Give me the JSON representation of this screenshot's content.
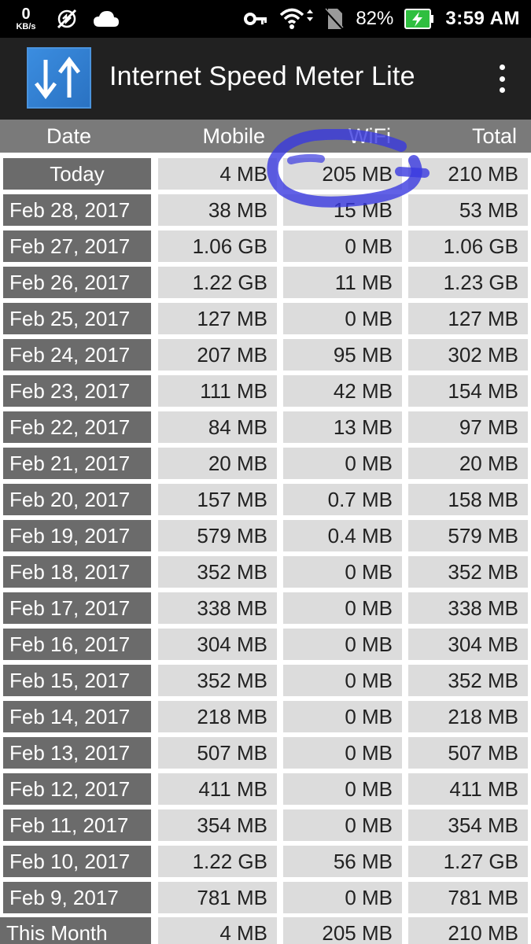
{
  "status_bar": {
    "net_speed_value": "0",
    "net_speed_unit": "KB/s",
    "battery_percent": "82%",
    "time": "3:59 AM",
    "icons": [
      "no-sync-icon",
      "cloud-icon",
      "key-icon",
      "wifi-icon",
      "no-sim-icon",
      "battery-charging-icon"
    ]
  },
  "app_bar": {
    "title": "Internet Speed Meter Lite",
    "logo_icon": "download-upload-arrows-icon",
    "menu_icon": "overflow-menu-icon"
  },
  "table": {
    "headers": [
      "Date",
      "Mobile",
      "WiFi",
      "Total"
    ],
    "rows": [
      {
        "date": "Today",
        "mobile": "4 MB",
        "wifi": "205 MB",
        "total": "210 MB"
      },
      {
        "date": "Feb 28, 2017",
        "mobile": "38 MB",
        "wifi": "15 MB",
        "total": "53 MB"
      },
      {
        "date": "Feb 27, 2017",
        "mobile": "1.06 GB",
        "wifi": "0 MB",
        "total": "1.06 GB"
      },
      {
        "date": "Feb 26, 2017",
        "mobile": "1.22 GB",
        "wifi": "11 MB",
        "total": "1.23 GB"
      },
      {
        "date": "Feb 25, 2017",
        "mobile": "127 MB",
        "wifi": "0 MB",
        "total": "127 MB"
      },
      {
        "date": "Feb 24, 2017",
        "mobile": "207 MB",
        "wifi": "95 MB",
        "total": "302 MB"
      },
      {
        "date": "Feb 23, 2017",
        "mobile": "111 MB",
        "wifi": "42 MB",
        "total": "154 MB"
      },
      {
        "date": "Feb 22, 2017",
        "mobile": "84 MB",
        "wifi": "13 MB",
        "total": "97 MB"
      },
      {
        "date": "Feb 21, 2017",
        "mobile": "20 MB",
        "wifi": "0 MB",
        "total": "20 MB"
      },
      {
        "date": "Feb 20, 2017",
        "mobile": "157 MB",
        "wifi": "0.7 MB",
        "total": "158 MB"
      },
      {
        "date": "Feb 19, 2017",
        "mobile": "579 MB",
        "wifi": "0.4 MB",
        "total": "579 MB"
      },
      {
        "date": "Feb 18, 2017",
        "mobile": "352 MB",
        "wifi": "0 MB",
        "total": "352 MB"
      },
      {
        "date": "Feb 17, 2017",
        "mobile": "338 MB",
        "wifi": "0 MB",
        "total": "338 MB"
      },
      {
        "date": "Feb 16, 2017",
        "mobile": "304 MB",
        "wifi": "0 MB",
        "total": "304 MB"
      },
      {
        "date": "Feb 15, 2017",
        "mobile": "352 MB",
        "wifi": "0 MB",
        "total": "352 MB"
      },
      {
        "date": "Feb 14, 2017",
        "mobile": "218 MB",
        "wifi": "0 MB",
        "total": "218 MB"
      },
      {
        "date": "Feb 13, 2017",
        "mobile": "507 MB",
        "wifi": "0 MB",
        "total": "507 MB"
      },
      {
        "date": "Feb 12, 2017",
        "mobile": "411 MB",
        "wifi": "0 MB",
        "total": "411 MB"
      },
      {
        "date": "Feb 11, 2017",
        "mobile": "354 MB",
        "wifi": "0 MB",
        "total": "354 MB"
      },
      {
        "date": "Feb 10, 2017",
        "mobile": "1.22 GB",
        "wifi": "56 MB",
        "total": "1.27 GB"
      },
      {
        "date": "Feb 9, 2017",
        "mobile": "781 MB",
        "wifi": "0 MB",
        "total": "781 MB"
      }
    ],
    "summary": {
      "date": "This Month",
      "mobile": "4 MB",
      "wifi": "205 MB",
      "total": "210 MB"
    }
  },
  "colors": {
    "status_bar_bg": "#000000",
    "app_bar_bg": "#212121",
    "header_bg": "#7a7a7a",
    "date_cell_bg": "#6b6b6b",
    "value_cell_bg": "#dcdcdc",
    "annotation_ink": "#3a3ae0"
  }
}
